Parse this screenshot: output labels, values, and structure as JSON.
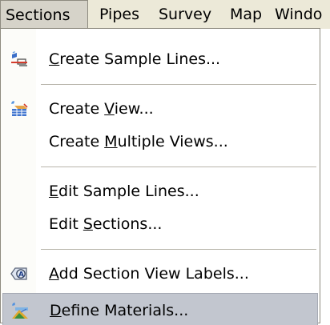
{
  "menubar": {
    "items": [
      {
        "label": "Sections"
      },
      {
        "label": "Pipes"
      },
      {
        "label": "Survey"
      },
      {
        "label": "Map"
      },
      {
        "label": "Windo"
      }
    ]
  },
  "menu": {
    "items": [
      {
        "pre": "",
        "acc": "C",
        "post": "reate Sample Lines...",
        "icon": "sample-lines-icon"
      },
      {
        "pre": "Create ",
        "acc": "V",
        "post": "iew...",
        "icon": "section-view-icon"
      },
      {
        "pre": "Create ",
        "acc": "M",
        "post": "ultiple Views...",
        "icon": ""
      },
      {
        "pre": "",
        "acc": "E",
        "post": "dit Sample Lines...",
        "icon": ""
      },
      {
        "pre": "Edit ",
        "acc": "S",
        "post": "ections...",
        "icon": ""
      },
      {
        "pre": "",
        "acc": "A",
        "post": "dd Section View Labels...",
        "icon": "view-labels-icon"
      },
      {
        "pre": "",
        "acc": "D",
        "post": "efine Materials...",
        "icon": "materials-icon"
      }
    ]
  },
  "colors": {
    "menubar_bg": "#ece9d8",
    "highlight_bg": "#c2c6cf",
    "open_menu_bg": "#d6d3c9"
  }
}
